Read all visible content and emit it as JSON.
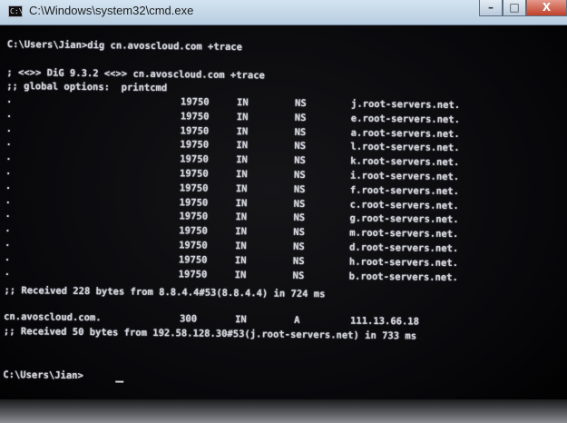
{
  "window": {
    "title": "C:\\Windows\\system32\\cmd.exe",
    "icon_label": "C:\\",
    "buttons": {
      "minimize": "–",
      "maximize": "□",
      "close": "X"
    }
  },
  "console": {
    "command_line": "C:\\Users\\Jian>dig cn.avoscloud.com +trace",
    "dig_header": "; <<>> DiG 9.3.2 <<>> cn.avoscloud.com +trace",
    "global_options": ";; global options:  printcmd",
    "root_records": [
      {
        "name": ".",
        "ttl": "19750",
        "class": "IN",
        "type": "NS",
        "data": "j.root-servers.net."
      },
      {
        "name": ".",
        "ttl": "19750",
        "class": "IN",
        "type": "NS",
        "data": "e.root-servers.net."
      },
      {
        "name": ".",
        "ttl": "19750",
        "class": "IN",
        "type": "NS",
        "data": "a.root-servers.net."
      },
      {
        "name": ".",
        "ttl": "19750",
        "class": "IN",
        "type": "NS",
        "data": "l.root-servers.net."
      },
      {
        "name": ".",
        "ttl": "19750",
        "class": "IN",
        "type": "NS",
        "data": "k.root-servers.net."
      },
      {
        "name": ".",
        "ttl": "19750",
        "class": "IN",
        "type": "NS",
        "data": "i.root-servers.net."
      },
      {
        "name": ".",
        "ttl": "19750",
        "class": "IN",
        "type": "NS",
        "data": "f.root-servers.net."
      },
      {
        "name": ".",
        "ttl": "19750",
        "class": "IN",
        "type": "NS",
        "data": "c.root-servers.net."
      },
      {
        "name": ".",
        "ttl": "19750",
        "class": "IN",
        "type": "NS",
        "data": "g.root-servers.net."
      },
      {
        "name": ".",
        "ttl": "19750",
        "class": "IN",
        "type": "NS",
        "data": "m.root-servers.net."
      },
      {
        "name": ".",
        "ttl": "19750",
        "class": "IN",
        "type": "NS",
        "data": "d.root-servers.net."
      },
      {
        "name": ".",
        "ttl": "19750",
        "class": "IN",
        "type": "NS",
        "data": "h.root-servers.net."
      },
      {
        "name": ".",
        "ttl": "19750",
        "class": "IN",
        "type": "NS",
        "data": "b.root-servers.net."
      }
    ],
    "received_1": ";; Received 228 bytes from 8.8.4.4#53(8.8.4.4) in 724 ms",
    "answer_record": {
      "name": "cn.avoscloud.com.",
      "ttl": "300",
      "class": "IN",
      "type": "A",
      "data": "111.13.66.18"
    },
    "received_2": ";; Received 50 bytes from 192.58.128.30#53(j.root-servers.net) in 733 ms",
    "prompt": "C:\\Users\\Jian>"
  }
}
